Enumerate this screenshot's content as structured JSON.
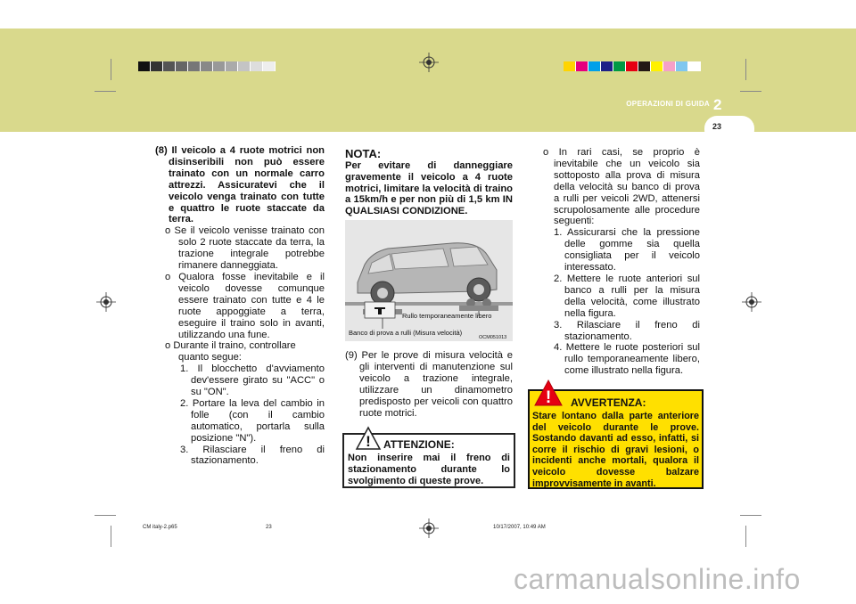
{
  "header": {
    "section_title": "OPERAZIONI DI GUIDA",
    "chapter_number": "2",
    "page_number": "23",
    "band_color": "#d9d98c",
    "gray_strip": [
      "#111111",
      "#333333",
      "#555555",
      "#666666",
      "#777777",
      "#888888",
      "#999999",
      "#aaaaaa",
      "#c4c4c4",
      "#dddddd",
      "#eeeeee"
    ],
    "color_strip": [
      "#ffd400",
      "#e6007e",
      "#00a0e9",
      "#1d2088",
      "#009944",
      "#e60012",
      "#231815",
      "#fff100",
      "#f5a0c8",
      "#7fc7ef",
      "#ffffff"
    ]
  },
  "col1": {
    "heading_num": "(8)",
    "heading": "Il veicolo a 4 ruote motrici non disinseribili non può essere trainato con un normale carro attrezzi. Assicuratevi che il veicolo venga trainato con tutte e quattro le ruote staccate da terra.",
    "bullet1": "o Se il veicolo venisse trainato con solo 2 ruote staccate da terra, la trazione integrale potrebbe rimanere danneggiata.",
    "bullet2": "o Qualora fosse inevitabile e il veicolo dovesse comunque essere trainato con tutte e 4 le ruote appoggiate a terra, eseguire il traino solo in avanti, utilizzando una fune.",
    "bullet3": "o Durante il traino, controllare quanto segue:",
    "step1": "1. Il blocchetto d'avviamento dev'essere girato su \"ACC\" o su \"ON\".",
    "step2": "2. Portare la leva del cambio in folle (con il cambio automatico, portarla sulla posizione \"N\").",
    "step3": "3. Rilasciare il freno di stazionamento."
  },
  "col2": {
    "nota_title": "NOTA:",
    "nota_text": "Per evitare di danneggiare gravemente il veicolo a 4 ruote motrici, limitare la velocità di traino a 15km/h e per non più di 1,5 km IN QUALSIASI CONDIZIONE.",
    "figure": {
      "label_roller": "Rullo temporaneamente libero",
      "label_dyno": "Banco di prova a rulli (Misura velocità)",
      "code": "OCM051013"
    },
    "item9": "(9) Per le prove di misura velocità e gli interventi di manutenzione sul veicolo a trazione integrale, utilizzare un dinamometro predisposto per veicoli con quattro ruote motrici.",
    "attention_title": "ATTENZIONE:",
    "attention_text": "Non inserire mai il freno di stazionamento durante lo svolgimento di queste prove."
  },
  "col3": {
    "bullet": "o In rari casi, se proprio è inevitabile che un veicolo sia sottoposto alla prova di misura della velocità su banco di prova a rulli per veicoli 2WD, attenersi scrupolosamente alle procedure seguenti:",
    "step1": "1. Assicurarsi che la pressione delle gomme sia quella consigliata per il veicolo interessato.",
    "step2": "2. Mettere le ruote anteriori sul banco a rulli per la misura della velocità, come illustrato nella figura.",
    "step3": "3. Rilasciare il freno di stazionamento.",
    "step4": "4. Mettere le ruote posteriori sul rullo temporaneamente libero, come illustrato nella figura.",
    "warning_title": "AVVERTENZA:",
    "warning_text": "Stare lontano dalla parte anteriore del veicolo durante le prove. Sostando davanti ad esso, infatti, si corre il rischio di gravi lesioni, o incidenti anche mortali, qualora il veicolo dovesse balzare improvvisamente in avanti."
  },
  "footer": {
    "file": "CM italy-2.p65",
    "page": "23",
    "date": "10/17/2007, 10:49 AM"
  },
  "watermark": "carmanualsonline.info"
}
